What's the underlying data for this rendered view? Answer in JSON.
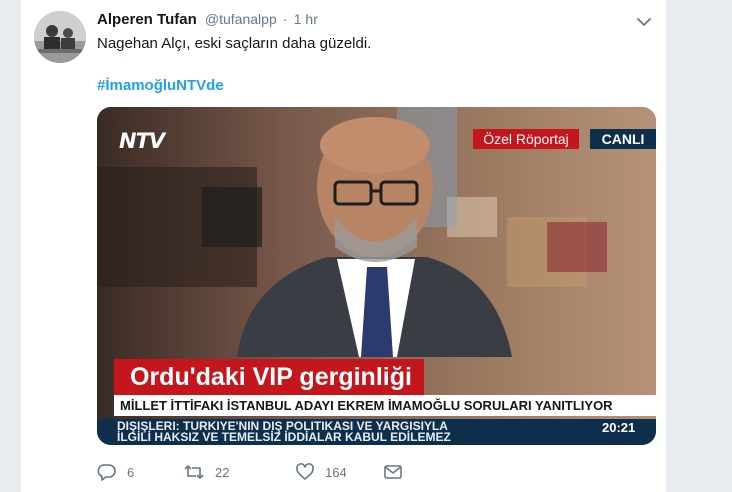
{
  "tweet": {
    "author_name": "Alperen Tufan",
    "handle": "@tufanalpp",
    "separator": "·",
    "time": "1 hr",
    "text": "Nagehan Alçı, eski saçların daha güzeldi.",
    "hashtag": "#İmamoğluNTVde"
  },
  "media": {
    "channel_logo": "NTV",
    "tag_label": "Özel Röportaj",
    "live_label": "CANLI",
    "headline": "Ordu'daki VIP gerginliği",
    "subline": "MİLLET İTTİFAKI İSTANBUL ADAYI EKREM İMAMOĞLU SORULARI YANITLIYOR",
    "ticker_line1": "DIŞİŞLERİ: TÜRKİYE'NİN DIŞ POLİTİKASI VE YARGISIYLA",
    "ticker_line2": "İLGİLİ HAKSIZ VE TEMELSİZ İDDİALAR KABUL EDİLEMEZ",
    "clock": "20:21"
  },
  "actions": {
    "replies": "6",
    "retweets": "22",
    "likes": "164"
  },
  "icons": {
    "more": "chevron-down-icon",
    "reply": "reply-icon",
    "retweet": "retweet-icon",
    "like": "heart-icon",
    "message": "envelope-icon"
  },
  "colors": {
    "accent": "#1da1f2",
    "text": "#14171a",
    "secondary": "#657786",
    "background": "#e6ecf0",
    "broadcast_red": "#c4161c",
    "broadcast_navy": "#0e2f4c"
  }
}
